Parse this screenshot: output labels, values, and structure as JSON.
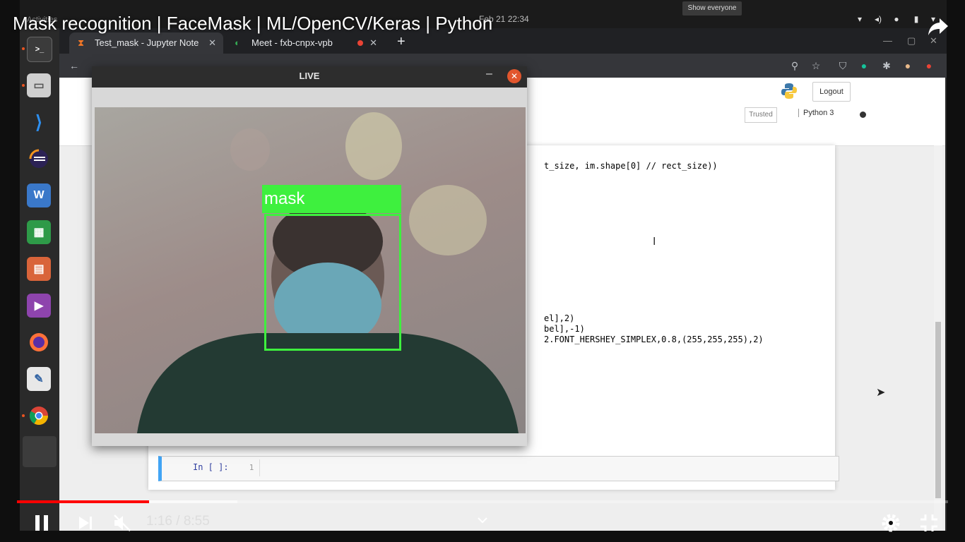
{
  "youtube": {
    "title": "Mask recognition | FaceMask | ML/OpenCV/Keras | Python",
    "time_display": "1:16 / 8:55",
    "progress_fraction": 0.142,
    "buffered_fraction": 0.237,
    "icons": [
      "share-icon",
      "pause-icon",
      "next-icon",
      "mute-icon",
      "chevron-down-icon",
      "settings-icon",
      "exit-fullscreen-icon"
    ]
  },
  "desktop": {
    "activities": "Activities",
    "clock": "Feb 21  22:34",
    "show_everyone": "Show everyone",
    "dock_apps": [
      "terminal",
      "files",
      "vscode",
      "eclipse",
      "writer",
      "calc",
      "impress",
      "videos",
      "firefox",
      "text-editor",
      "chrome",
      "app-grid"
    ]
  },
  "browser": {
    "tabs": [
      {
        "label": "Test_mask - Jupyter Note"
      },
      {
        "label": "Meet - fxb-cnpx-vpb"
      }
    ],
    "new_tab": "+"
  },
  "jupyter": {
    "logout": "Logout",
    "trusted": "Trusted",
    "kernel": "Python 3",
    "code_lines": [
      "t_size, im.shape[0] // rect_size))",
      "el],2)",
      "bel],-1)",
      "2.FONT_HERSHEY_SIMPLEX,0.8,(255,255,255),2)"
    ],
    "empty_cell_prompt": "In [ ]:",
    "empty_cell_lineno": "1"
  },
  "live_window": {
    "title": "LIVE",
    "detection_label": "mask",
    "box_color": "#3ef03e"
  }
}
